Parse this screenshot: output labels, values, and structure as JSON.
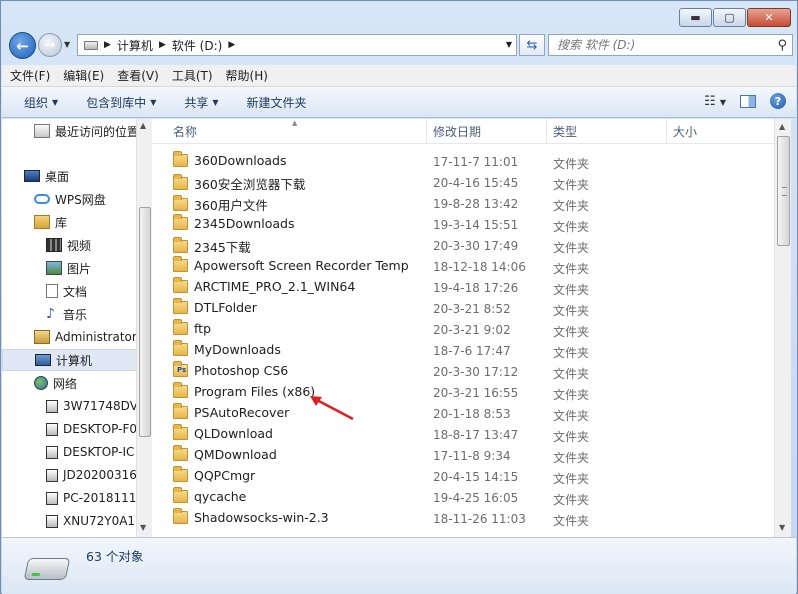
{
  "window": {
    "minimize_glyph": "▬",
    "maximize_glyph": "▢",
    "close_glyph": "✕"
  },
  "address": {
    "crumbs": [
      "计算机",
      "软件 (D:)"
    ]
  },
  "search": {
    "placeholder": "搜索 软件 (D:)"
  },
  "menu": [
    "文件(F)",
    "编辑(E)",
    "查看(V)",
    "工具(T)",
    "帮助(H)"
  ],
  "commands": {
    "organize": "组织",
    "include_library": "包含到库中",
    "share": "共享",
    "new_folder": "新建文件夹"
  },
  "nav": [
    {
      "label": "最近访问的位置",
      "icon": "recent-places-icon"
    },
    {
      "label": "桌面",
      "icon": "desktop-icon"
    },
    {
      "label": "WPS网盘",
      "icon": "cloud-drive-icon"
    },
    {
      "label": "库",
      "icon": "library-icon"
    },
    {
      "label": "视频",
      "icon": "video-library-icon"
    },
    {
      "label": "图片",
      "icon": "picture-library-icon"
    },
    {
      "label": "文档",
      "icon": "document-library-icon"
    },
    {
      "label": "音乐",
      "icon": "music-library-icon"
    },
    {
      "label": "Administrator",
      "icon": "user-folder-icon"
    },
    {
      "label": "计算机",
      "icon": "computer-icon"
    },
    {
      "label": "网络",
      "icon": "network-icon"
    },
    {
      "label": "3W71748DV",
      "icon": "network-computer-icon"
    },
    {
      "label": "DESKTOP-F0",
      "icon": "network-computer-icon"
    },
    {
      "label": "DESKTOP-IC",
      "icon": "network-computer-icon"
    },
    {
      "label": "JD20200316",
      "icon": "network-computer-icon"
    },
    {
      "label": "PC-2018111",
      "icon": "network-computer-icon"
    },
    {
      "label": "XNU72Y0A1",
      "icon": "network-computer-icon"
    }
  ],
  "columns": {
    "name": "名称",
    "modified": "修改日期",
    "type": "类型",
    "size": "大小"
  },
  "files": [
    {
      "name": "360Downloads",
      "date": "17-11-7 11:01",
      "type": "文件夹"
    },
    {
      "name": "360安全浏览器下载",
      "date": "20-4-16 15:45",
      "type": "文件夹"
    },
    {
      "name": "360用户文件",
      "date": "19-8-28 13:42",
      "type": "文件夹"
    },
    {
      "name": "2345Downloads",
      "date": "19-3-14 15:51",
      "type": "文件夹"
    },
    {
      "name": "2345下载",
      "date": "20-3-30 17:49",
      "type": "文件夹"
    },
    {
      "name": "Apowersoft Screen Recorder Temp",
      "date": "18-12-18 14:06",
      "type": "文件夹"
    },
    {
      "name": "ARCTIME_PRO_2.1_WIN64",
      "date": "19-4-18 17:26",
      "type": "文件夹"
    },
    {
      "name": "DTLFolder",
      "date": "20-3-21 8:52",
      "type": "文件夹"
    },
    {
      "name": "ftp",
      "date": "20-3-21 9:02",
      "type": "文件夹"
    },
    {
      "name": "MyDownloads",
      "date": "18-7-6 17:47",
      "type": "文件夹"
    },
    {
      "name": "Photoshop CS6",
      "date": "20-3-30 17:12",
      "type": "文件夹"
    },
    {
      "name": "Program Files (x86)",
      "date": "20-3-21 16:55",
      "type": "文件夹"
    },
    {
      "name": "PSAutoRecover",
      "date": "20-1-18 8:53",
      "type": "文件夹"
    },
    {
      "name": "QLDownload",
      "date": "18-8-17 13:47",
      "type": "文件夹"
    },
    {
      "name": "QMDownload",
      "date": "17-11-8 9:34",
      "type": "文件夹"
    },
    {
      "name": "QQPCmgr",
      "date": "20-4-15 14:15",
      "type": "文件夹"
    },
    {
      "name": "qycache",
      "date": "19-4-25 16:05",
      "type": "文件夹"
    },
    {
      "name": "Shadowsocks-win-2.3",
      "date": "18-11-26 11:03",
      "type": "文件夹"
    }
  ],
  "status": {
    "count_text": "63 个对象"
  },
  "colors": {
    "accent": "#1f5fb8",
    "annotation_arrow": "#e02020"
  }
}
